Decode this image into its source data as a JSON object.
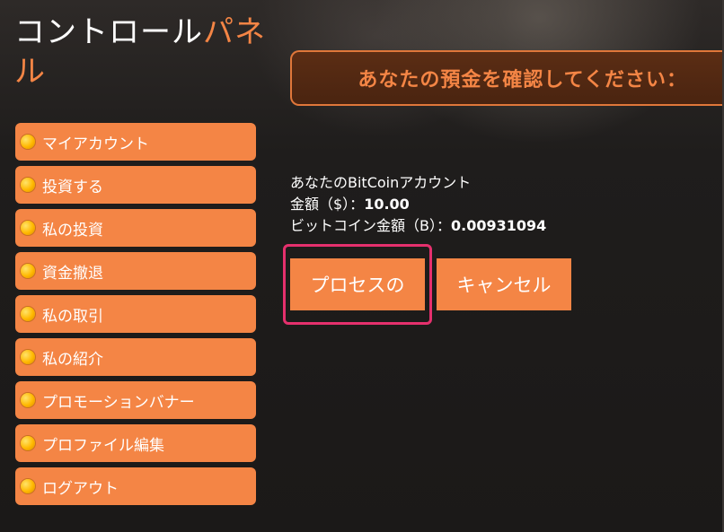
{
  "header": {
    "title_main": "コントロール",
    "title_accent_1": "パネ",
    "title_accent_2": "ル"
  },
  "sidebar": {
    "items": [
      {
        "label": "マイアカウント"
      },
      {
        "label": "投資する"
      },
      {
        "label": "私の投資"
      },
      {
        "label": "資金撤退"
      },
      {
        "label": "私の取引"
      },
      {
        "label": "私の紹介"
      },
      {
        "label": "プロモーションバナー"
      },
      {
        "label": "プロファイル編集"
      },
      {
        "label": "ログアウト"
      }
    ]
  },
  "main": {
    "banner": "あなたの預金を確認してください：",
    "account_line": "あなたのBitCoinアカウント",
    "amount_label": "金額（$）：",
    "amount_value": "10.00",
    "btc_label": "ビットコイン金額（B）：",
    "btc_value": "0.00931094",
    "process_button": "プロセスの",
    "cancel_button": "キャンセル"
  },
  "colors": {
    "accent": "#f48545",
    "highlight": "#e5306d",
    "background": "#1c1a19"
  }
}
